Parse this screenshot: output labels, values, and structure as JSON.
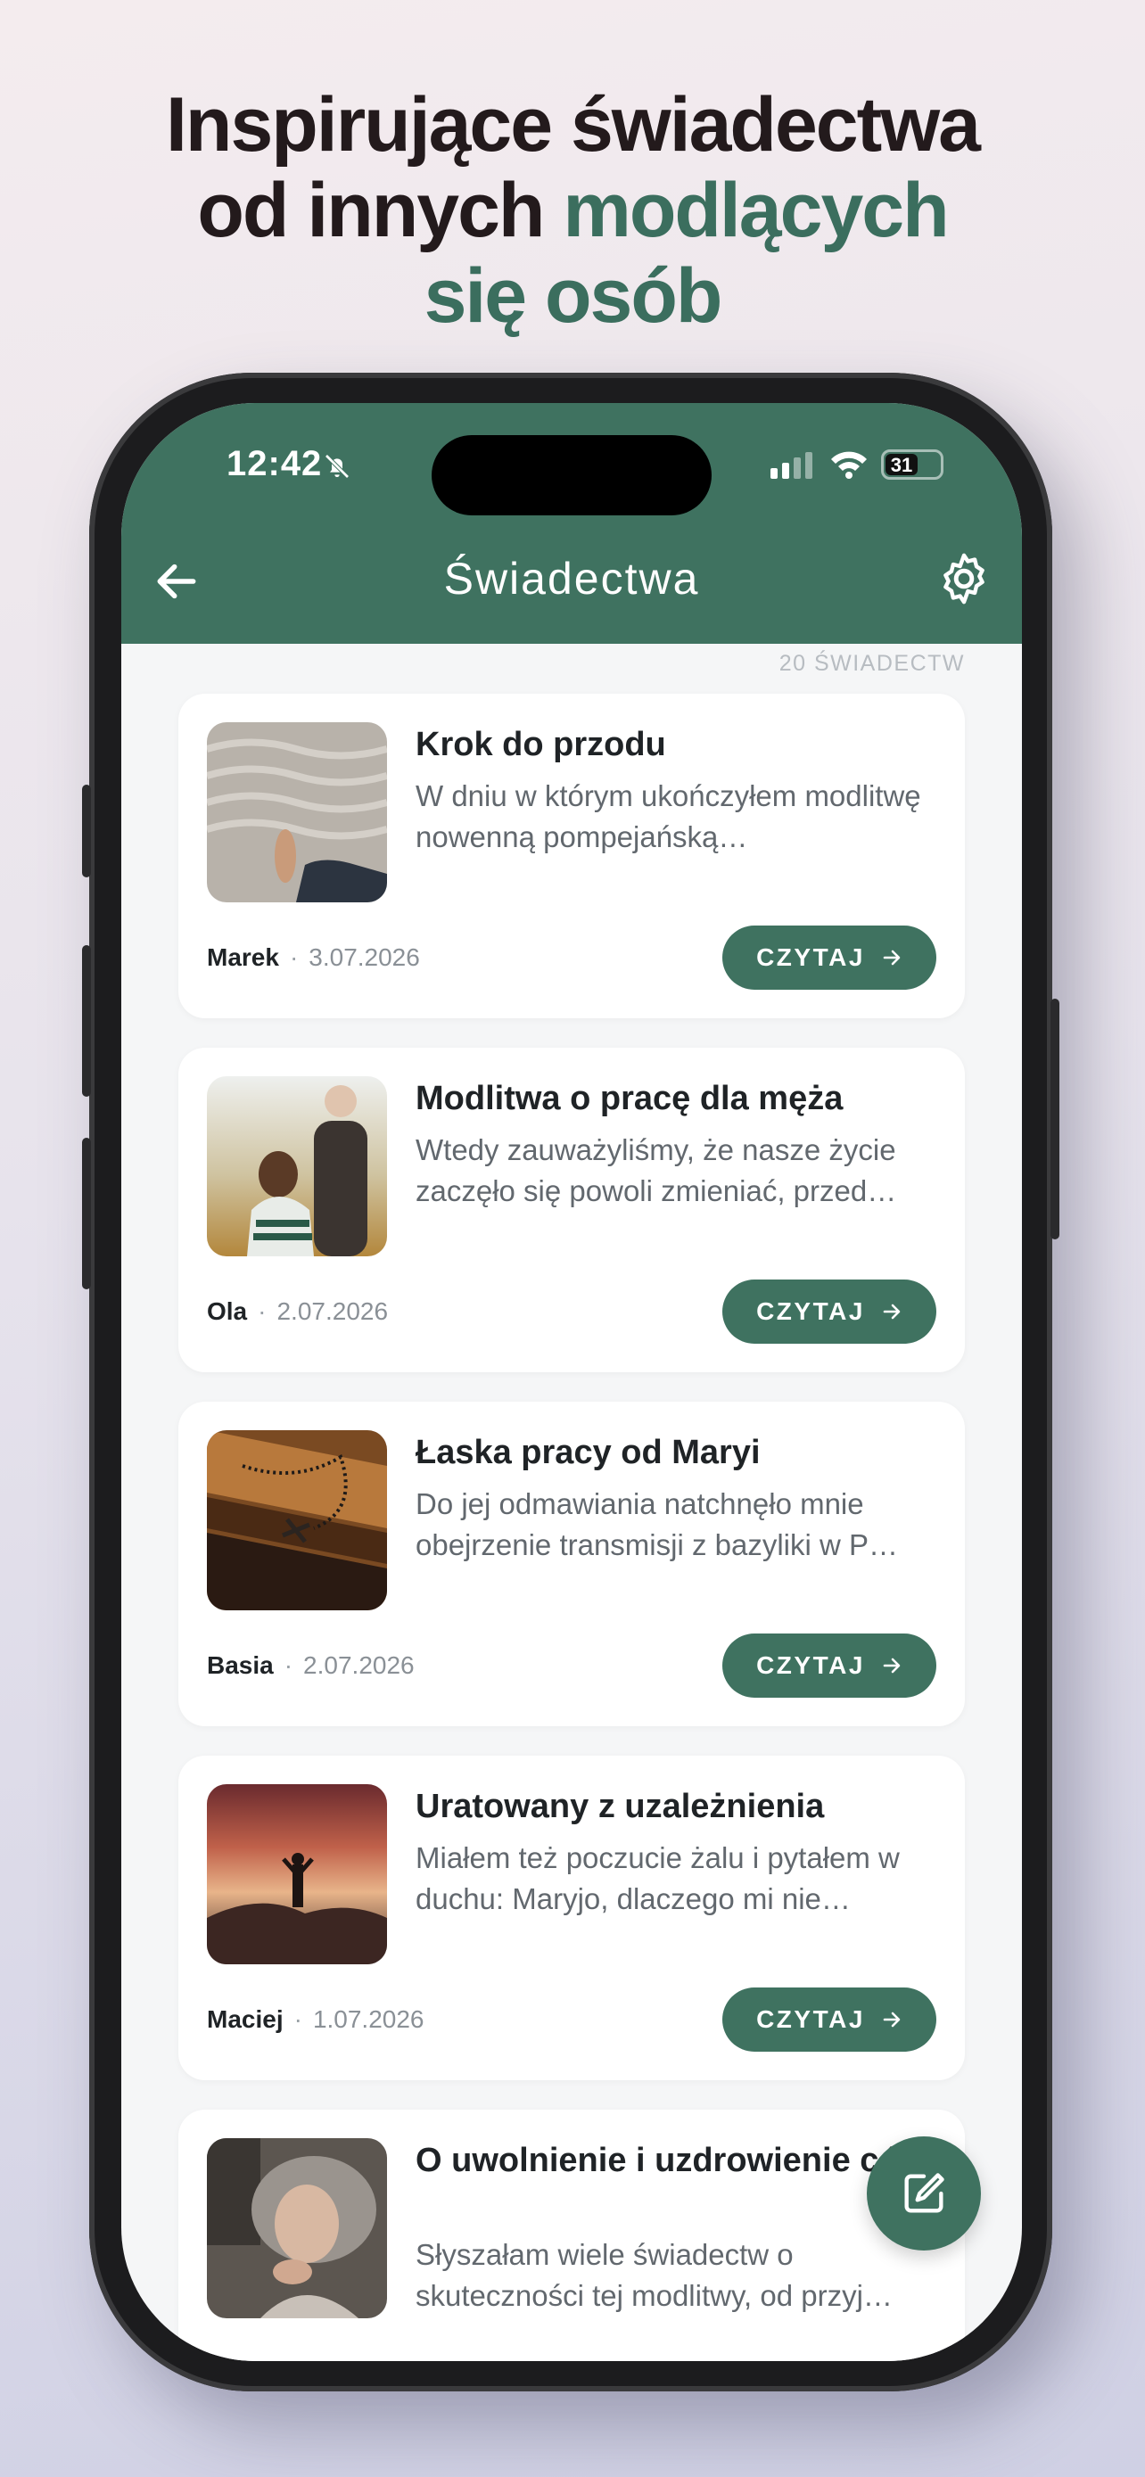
{
  "headline": {
    "line1": "Inspirujące świadectwa",
    "line2_plain": "od innych ",
    "line2_accent": "modlących",
    "line3_accent": "się osób"
  },
  "status_bar": {
    "time": "12:42",
    "battery": "31"
  },
  "app_bar": {
    "title": "Świadectwa"
  },
  "list_count": "20 ŚWIADECTW",
  "cards": [
    {
      "title": "Krok do przodu",
      "excerpt": "W dniu w którym ukończyłem modlitwę nowenną pompejańską…",
      "author": "Marek",
      "date": "3.07.2026",
      "button": "CZYTAJ"
    },
    {
      "title": "Modlitwa o pracę dla męża",
      "excerpt": "Wtedy zauważyliśmy, że nasze życie zaczęło się powoli zmieniać, przed…",
      "author": "Ola",
      "date": "2.07.2026",
      "button": "CZYTAJ"
    },
    {
      "title": "Łaska pracy od Maryi",
      "excerpt": "Do jej odmawiania natchnęło mnie obejrzenie transmisji z bazyliki w P…",
      "author": "Basia",
      "date": "2.07.2026",
      "button": "CZYTAJ"
    },
    {
      "title": "Uratowany z uzależnienia",
      "excerpt": "Miałem też poczucie żalu i pytałem w duchu: Maryjo, dlaczego mi nie…",
      "author": "Maciej",
      "date": "1.07.2026",
      "button": "CZYTAJ"
    },
    {
      "title": "O uwolnienie i uzdrowienie córki",
      "excerpt": "Słyszałam wiele świadectw o skuteczności tej modlitwy, od przyj…",
      "author": "",
      "date": "",
      "button": ""
    }
  ],
  "colors": {
    "accent": "#3f7260",
    "headline_dark": "#231a1c",
    "headline_accent": "#3b6e5e"
  },
  "icons": {
    "back": "arrow-left-icon",
    "settings": "gear-icon",
    "fab": "edit-icon",
    "read": "arrow-right-icon"
  }
}
